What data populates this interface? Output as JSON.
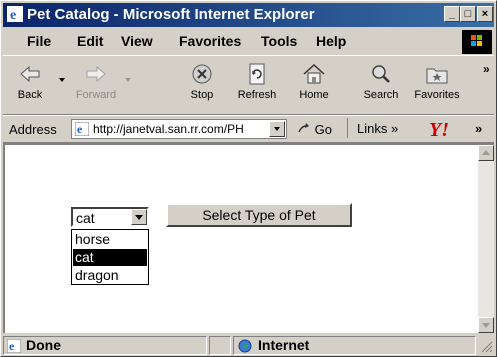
{
  "window": {
    "title": "Pet Catalog - Microsoft Internet Explorer"
  },
  "menu": [
    "File",
    "Edit",
    "View",
    "Favorites",
    "Tools",
    "Help"
  ],
  "toolbar": {
    "back": "Back",
    "forward": "Forward",
    "stop": "Stop",
    "refresh": "Refresh",
    "home": "Home",
    "search": "Search",
    "favorites": "Favorites",
    "more": "»"
  },
  "address": {
    "label": "Address",
    "url": "http://janetval.san.rr.com/PH",
    "go": "Go",
    "links": "Links »",
    "more": "»"
  },
  "page": {
    "select_value": "cat",
    "options": [
      "horse",
      "cat",
      "dragon"
    ],
    "selected_option": "cat",
    "submit_label": "Select Type of Pet"
  },
  "status": {
    "text": "Done",
    "zone": "Internet"
  },
  "colors": {
    "title_start": "#0a246a",
    "title_end": "#3a6ea5",
    "chrome": "#d4d0c8",
    "yahoo_red": "#d40000"
  }
}
